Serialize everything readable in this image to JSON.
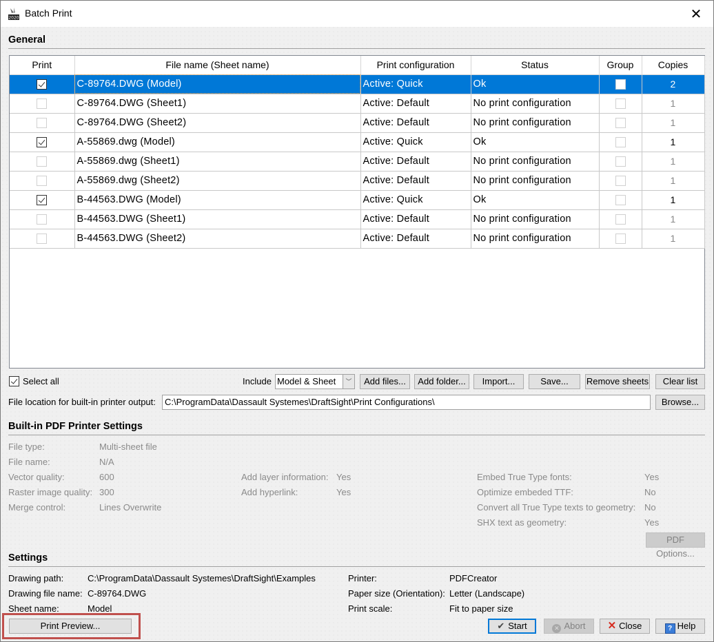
{
  "window": {
    "title": "Batch Print",
    "app_icon": "draftsight-2020-icon",
    "close_icon": "close-icon"
  },
  "general": {
    "section_title": "General",
    "columns": [
      "Print",
      "File name (Sheet name)",
      "Print configuration",
      "Status",
      "Group",
      "Copies"
    ],
    "rows": [
      {
        "print": true,
        "file": "C-89764.DWG (Model)",
        "config": "Active: Quick",
        "status": "Ok",
        "group": false,
        "copies": "2",
        "selected": true,
        "enabled": true
      },
      {
        "print": false,
        "file": "C-89764.DWG (Sheet1)",
        "config": "Active: Default",
        "status": "No print configuration",
        "group": false,
        "copies": "1",
        "selected": false,
        "enabled": false
      },
      {
        "print": false,
        "file": "C-89764.DWG (Sheet2)",
        "config": "Active: Default",
        "status": "No print configuration",
        "group": false,
        "copies": "1",
        "selected": false,
        "enabled": false
      },
      {
        "print": true,
        "file": "A-55869.dwg (Model)",
        "config": "Active: Quick",
        "status": "Ok",
        "group": false,
        "copies": "1",
        "selected": false,
        "enabled": true
      },
      {
        "print": false,
        "file": "A-55869.dwg (Sheet1)",
        "config": "Active: Default",
        "status": "No print configuration",
        "group": false,
        "copies": "1",
        "selected": false,
        "enabled": false
      },
      {
        "print": false,
        "file": "A-55869.dwg (Sheet2)",
        "config": "Active: Default",
        "status": "No print configuration",
        "group": false,
        "copies": "1",
        "selected": false,
        "enabled": false
      },
      {
        "print": true,
        "file": "B-44563.DWG (Model)",
        "config": "Active: Quick",
        "status": "Ok",
        "group": false,
        "copies": "1",
        "selected": false,
        "enabled": true
      },
      {
        "print": false,
        "file": "B-44563.DWG (Sheet1)",
        "config": "Active: Default",
        "status": "No print configuration",
        "group": false,
        "copies": "1",
        "selected": false,
        "enabled": false
      },
      {
        "print": false,
        "file": "B-44563.DWG (Sheet2)",
        "config": "Active: Default",
        "status": "No print configuration",
        "group": false,
        "copies": "1",
        "selected": false,
        "enabled": false
      }
    ],
    "select_all_label": "Select all",
    "select_all_checked": true,
    "include_label": "Include",
    "include_value": "Model & Sheet",
    "buttons": {
      "add_files": "Add files...",
      "add_folder": "Add folder...",
      "import": "Import...",
      "save": "Save...",
      "remove_sheets": "Remove sheets",
      "clear_list": "Clear list",
      "browse": "Browse..."
    },
    "file_location_label": "File location for built-in printer output:",
    "file_location_value": "C:\\ProgramData\\Dassault Systemes\\DraftSight\\Print Configurations\\"
  },
  "pdf_settings": {
    "section_title": "Built-in PDF Printer Settings",
    "col1": [
      {
        "label": "File type:",
        "value": "Multi-sheet file"
      },
      {
        "label": "File name:",
        "value": "N/A"
      },
      {
        "label": "Vector quality:",
        "value": "600"
      },
      {
        "label": "Raster image quality:",
        "value": "300"
      },
      {
        "label": "Merge control:",
        "value": "Lines Overwrite"
      }
    ],
    "col2": [
      {
        "label": "Add layer information:",
        "value": "Yes"
      },
      {
        "label": "Add hyperlink:",
        "value": "Yes"
      }
    ],
    "col3": [
      {
        "label": "Embed True Type fonts:",
        "value": "Yes"
      },
      {
        "label": "Optimize embeded TTF:",
        "value": "No"
      },
      {
        "label": "Convert all True Type texts to geometry:",
        "value": "No"
      },
      {
        "label": "SHX text as geometry:",
        "value": "Yes"
      }
    ],
    "pdf_options_button": "PDF Options..."
  },
  "settings": {
    "section_title": "Settings",
    "left": [
      {
        "label": "Drawing path:",
        "value": "C:\\ProgramData\\Dassault Systemes\\DraftSight\\Examples"
      },
      {
        "label": "Drawing file name:",
        "value": "C-89764.DWG"
      },
      {
        "label": "Sheet name:",
        "value": "Model"
      }
    ],
    "right": [
      {
        "label": "Printer:",
        "value": "PDFCreator"
      },
      {
        "label": "Paper size (Orientation):",
        "value": "Letter (Landscape)"
      },
      {
        "label": "Print scale:",
        "value": "Fit to paper size"
      }
    ],
    "print_preview_button": "Print Preview..."
  },
  "footer": {
    "start": "Start",
    "abort": "Abort",
    "close": "Close",
    "help": "Help"
  },
  "colors": {
    "selection": "#0078d7",
    "highlight_annotation": "#c0504d"
  }
}
